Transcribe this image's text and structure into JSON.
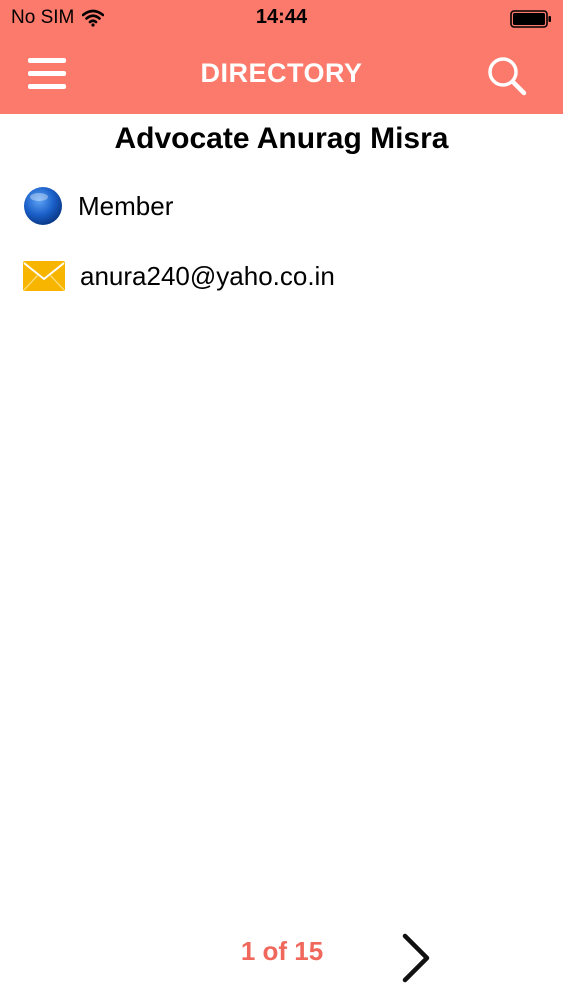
{
  "status_bar": {
    "carrier": "No SIM",
    "time": "14:44"
  },
  "nav": {
    "title": "DIRECTORY",
    "left_icon": "hamburger-menu-icon",
    "right_icon": "search-icon"
  },
  "member": {
    "name": "Advocate Anurag Misra",
    "type": "Member",
    "type_icon": "globe-icon",
    "email": "anura240@yaho.co.in",
    "email_icon": "envelope-icon"
  },
  "pager": {
    "label": "1 of 15",
    "next_icon": "chevron-right-icon"
  },
  "colors": {
    "header": "#fb7a6b",
    "pager_text": "#f0685c",
    "globe": "#1a5fc8",
    "envelope": "#f7b500"
  }
}
